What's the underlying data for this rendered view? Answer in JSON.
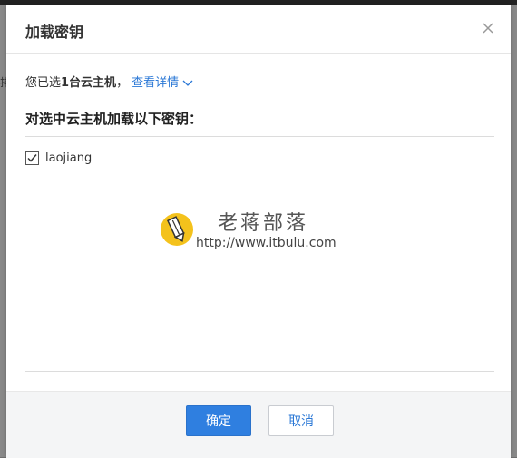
{
  "dialog": {
    "title": "加载密钥",
    "selection_prefix": "您已选",
    "selection_count": "1台云主机",
    "selection_sep": "，",
    "details_link": "查看详情",
    "section_title": "对选中云主机加载以下密钥：",
    "keys": [
      {
        "label": "laojiang",
        "checked": true
      }
    ],
    "confirm_label": "确定",
    "cancel_label": "取消"
  },
  "watermark": {
    "title": "老蒋部落",
    "url": "http://www.itbulu.com"
  },
  "background": {
    "edge_char": "排"
  },
  "colors": {
    "accent": "#2f7fe0",
    "link": "#2b78d6",
    "footer_bg": "#f4f5f6",
    "logo_yellow": "#f4c21c"
  }
}
